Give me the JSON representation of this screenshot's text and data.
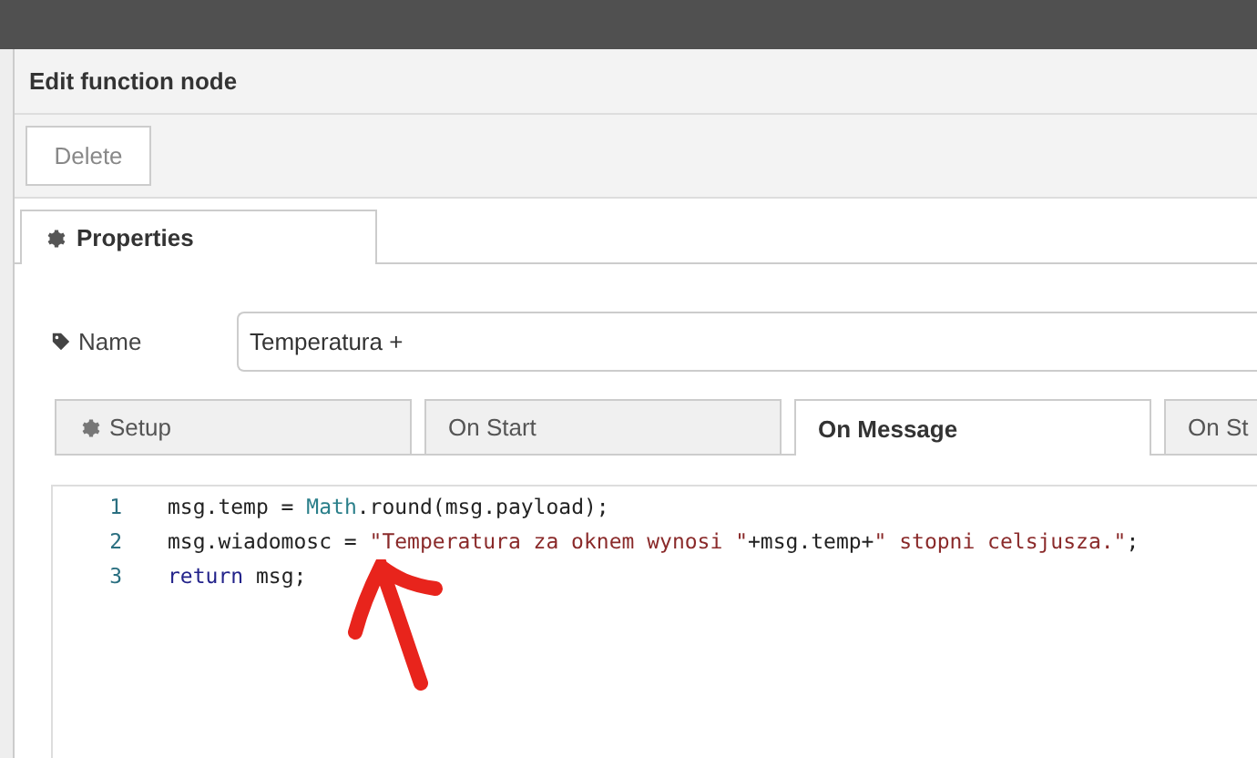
{
  "panel": {
    "title": "Edit function node"
  },
  "toolbar": {
    "buttons": [
      {
        "label": "Delete",
        "disabled": true
      }
    ]
  },
  "tabs": [
    {
      "label": "Properties",
      "selected": true
    }
  ],
  "name_field": {
    "label": "Name",
    "value": "Temperatura +"
  },
  "code_tabs": [
    {
      "kind": "with_icon",
      "label": "Setup",
      "selected": false
    },
    {
      "kind": "plain",
      "label": "On Start",
      "selected": false
    },
    {
      "kind": "plain",
      "label": "On Message",
      "selected": true
    },
    {
      "kind": "plain",
      "label": "On St",
      "selected": false
    }
  ],
  "code_lines": [
    {
      "number": "1",
      "tokens": [
        {
          "kind": "plain",
          "text": "msg.temp = "
        },
        {
          "kind": "builtin",
          "text": "Math"
        },
        {
          "kind": "plain",
          "text": ".round(msg.payload);"
        }
      ]
    },
    {
      "number": "2",
      "tokens": [
        {
          "kind": "plain",
          "text": "msg.wiadomosc = "
        },
        {
          "kind": "string",
          "text": "\"Temperatura za oknem wynosi \""
        },
        {
          "kind": "plain",
          "text": "+msg.temp+"
        },
        {
          "kind": "string",
          "text": "\" stopni celsjusza.\""
        },
        {
          "kind": "plain",
          "text": ";"
        }
      ]
    },
    {
      "number": "3",
      "tokens": [
        {
          "kind": "keyword",
          "text": "return"
        },
        {
          "kind": "plain",
          "text": " msg;"
        }
      ]
    }
  ]
}
